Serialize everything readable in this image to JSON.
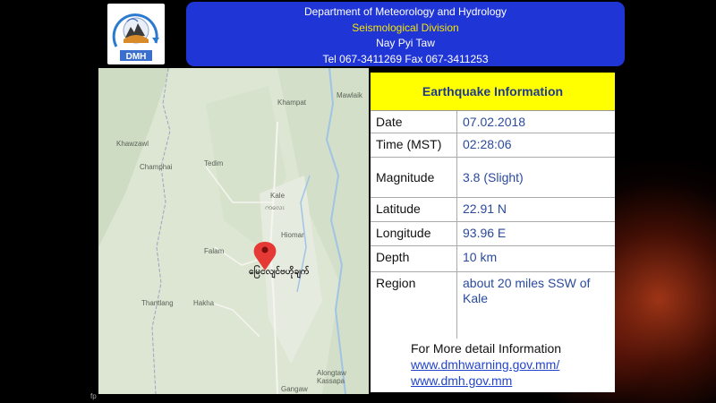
{
  "header": {
    "line1": "Department of Meteorology and Hydrology",
    "line2": "Seismological Division",
    "line3": "Nay Pyi Taw",
    "line4": "Tel 067-3411269 Fax 067-3411253"
  },
  "logo": {
    "text": "DMH"
  },
  "map": {
    "place_labels": [
      "Khampat",
      "Mawlaik",
      "Khawzawl",
      "Champhai",
      "Tedim",
      "Kale",
      "ကလေး",
      "Hiomar",
      "Falam",
      "Hakha",
      "Thantlang",
      "Alongtaw Kassapa",
      "Gangaw"
    ],
    "epicenter_label": "မြေငလျင်ဗဟိုချက်"
  },
  "info": {
    "title": "Earthquake Information",
    "rows": [
      {
        "label": "Date",
        "value": "07.02.2018"
      },
      {
        "label": "Time (MST)",
        "value": "02:28:06"
      },
      {
        "label": "Magnitude",
        "value": "3.8 (Slight)"
      },
      {
        "label": "Latitude",
        "value": "22.91 N"
      },
      {
        "label": "Longitude",
        "value": "93.96 E"
      },
      {
        "label": "Depth",
        "value": "10 km"
      },
      {
        "label": "Region",
        "value": "about 20 miles SSW of Kale"
      }
    ]
  },
  "more": {
    "heading": "For More detail Information",
    "link1": "www.dmhwarning.gov.mm/",
    "link2": "www.dmh.gov.mm"
  },
  "corner_text": "fp"
}
